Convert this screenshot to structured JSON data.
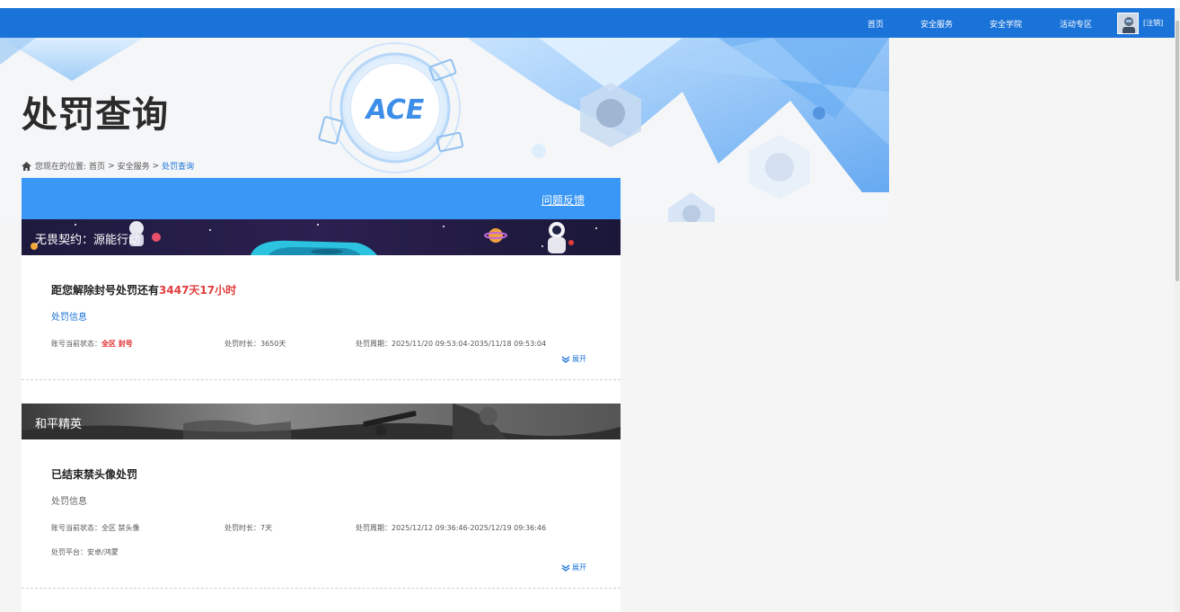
{
  "nav": {
    "items": [
      "首页",
      "安全服务",
      "安全学院",
      "活动专区"
    ],
    "user": "[注销]"
  },
  "page": {
    "title": "处罚查询",
    "logo_text": "ACE"
  },
  "breadcrumb": {
    "prefix": "您现在的位置:",
    "items": [
      "首页",
      "安全服务"
    ],
    "current": "处罚查询",
    "separator": ">"
  },
  "panel": {
    "feedback": "问题反馈"
  },
  "records": [
    {
      "game": "无畏契约：源能行动",
      "title_prefix": "距您解除封号处罚还有",
      "title_highlight": "3447天17小时",
      "info_label": "处罚信息",
      "status_label": "账号当前状态：",
      "status_value": "全区 封号",
      "duration": "处罚时长：3650天",
      "period": "处罚周期：2025/11/20 09:53:04-2035/11/18 09:53:04",
      "expand": "展开"
    },
    {
      "game": "和平精英",
      "title": "已结束禁头像处罚",
      "info_label": "处罚信息",
      "status": "账号当前状态：全区 禁头像",
      "duration": "处罚时长：7天",
      "period": "处罚周期：2025/12/12 09:36:46-2025/12/19 09:36:46",
      "platform": "处罚平台：安卓/鸿蒙",
      "expand": "展开"
    }
  ],
  "colors": {
    "nav_bg": "#1a73d9",
    "panel_head": "#3a97f5",
    "highlight": "#e23c3c",
    "link": "#1a73d9"
  }
}
